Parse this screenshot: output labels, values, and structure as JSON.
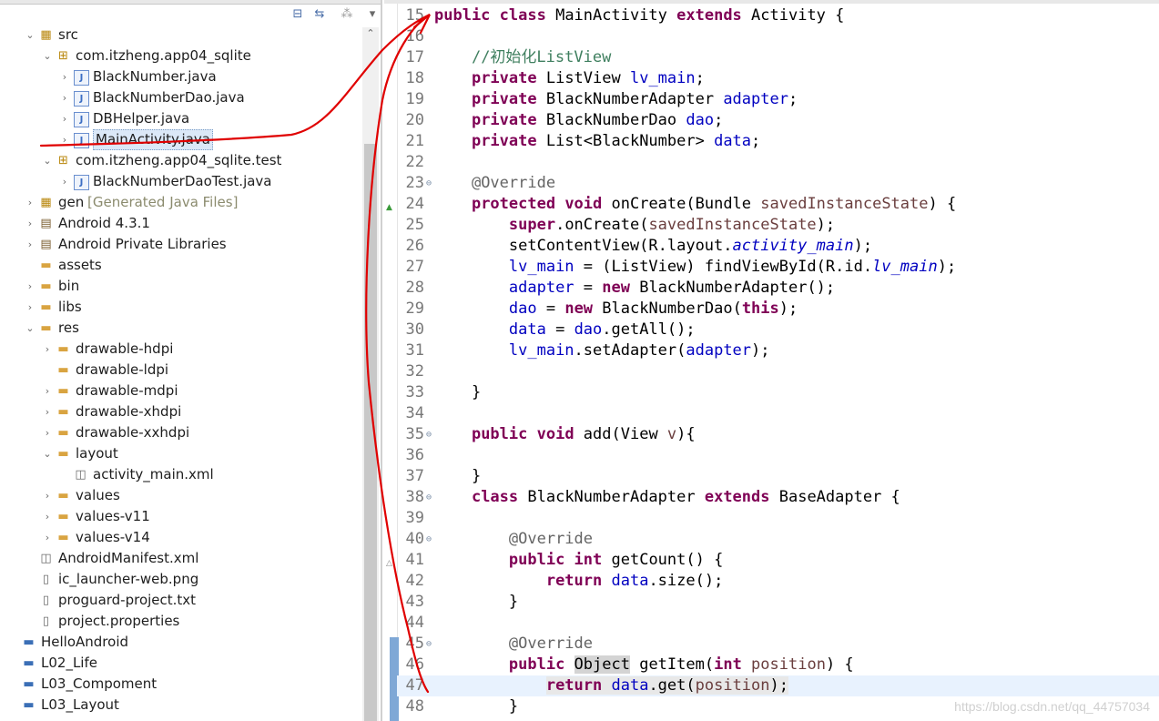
{
  "explorer": {
    "toolbar": {
      "collapse_icon": "collapse-all-icon",
      "link_icon": "link-with-editor-icon",
      "filter_icon": "filters-icon",
      "menu_icon": "view-menu-icon"
    },
    "tree": [
      {
        "id": "src",
        "label": "src",
        "indent": 1,
        "chev": "expanded",
        "icon": "package-folder-icon"
      },
      {
        "id": "pkg-main",
        "label": "com.itzheng.app04_sqlite",
        "indent": 2,
        "chev": "expanded",
        "icon": "package-icon"
      },
      {
        "id": "file-blacknumber",
        "label": "BlackNumber.java",
        "indent": 3,
        "chev": "collapsed",
        "icon": "java-file-icon"
      },
      {
        "id": "file-blacknumberdao",
        "label": "BlackNumberDao.java",
        "indent": 3,
        "chev": "collapsed",
        "icon": "java-file-icon"
      },
      {
        "id": "file-dbhelper",
        "label": "DBHelper.java",
        "indent": 3,
        "chev": "collapsed",
        "icon": "java-file-icon"
      },
      {
        "id": "file-mainactivity",
        "label": "MainActivity.java",
        "indent": 3,
        "chev": "collapsed",
        "icon": "java-file-icon",
        "selected": true
      },
      {
        "id": "pkg-test",
        "label": "com.itzheng.app04_sqlite.test",
        "indent": 2,
        "chev": "expanded",
        "icon": "package-icon"
      },
      {
        "id": "file-daotest",
        "label": "BlackNumberDaoTest.java",
        "indent": 3,
        "chev": "collapsed",
        "icon": "java-file-icon"
      },
      {
        "id": "gen",
        "label": "gen",
        "decor": "[Generated Java Files]",
        "indent": 1,
        "chev": "collapsed",
        "icon": "package-folder-icon"
      },
      {
        "id": "android",
        "label": "Android 4.3.1",
        "indent": 1,
        "chev": "collapsed",
        "icon": "library-icon"
      },
      {
        "id": "private-libs",
        "label": "Android Private Libraries",
        "indent": 1,
        "chev": "collapsed",
        "icon": "library-icon"
      },
      {
        "id": "assets",
        "label": "assets",
        "indent": 1,
        "chev": "none",
        "icon": "folder-icon"
      },
      {
        "id": "bin",
        "label": "bin",
        "indent": 1,
        "chev": "collapsed",
        "icon": "folder-icon"
      },
      {
        "id": "libs",
        "label": "libs",
        "indent": 1,
        "chev": "collapsed",
        "icon": "folder-icon"
      },
      {
        "id": "res",
        "label": "res",
        "indent": 1,
        "chev": "expanded",
        "icon": "folder-icon"
      },
      {
        "id": "drawable-hdpi",
        "label": "drawable-hdpi",
        "indent": 2,
        "chev": "collapsed",
        "icon": "folder-icon"
      },
      {
        "id": "drawable-ldpi",
        "label": "drawable-ldpi",
        "indent": 2,
        "chev": "none",
        "icon": "folder-icon"
      },
      {
        "id": "drawable-mdpi",
        "label": "drawable-mdpi",
        "indent": 2,
        "chev": "collapsed",
        "icon": "folder-icon"
      },
      {
        "id": "drawable-xhdpi",
        "label": "drawable-xhdpi",
        "indent": 2,
        "chev": "collapsed",
        "icon": "folder-icon"
      },
      {
        "id": "drawable-xxhdpi",
        "label": "drawable-xxhdpi",
        "indent": 2,
        "chev": "collapsed",
        "icon": "folder-icon"
      },
      {
        "id": "layout",
        "label": "layout",
        "indent": 2,
        "chev": "expanded",
        "icon": "folder-icon"
      },
      {
        "id": "activity-main-xml",
        "label": "activity_main.xml",
        "indent": 3,
        "chev": "none",
        "icon": "xml-file-icon"
      },
      {
        "id": "values",
        "label": "values",
        "indent": 2,
        "chev": "collapsed",
        "icon": "folder-icon"
      },
      {
        "id": "values-v11",
        "label": "values-v11",
        "indent": 2,
        "chev": "collapsed",
        "icon": "folder-icon"
      },
      {
        "id": "values-v14",
        "label": "values-v14",
        "indent": 2,
        "chev": "collapsed",
        "icon": "folder-icon"
      },
      {
        "id": "manifest",
        "label": "AndroidManifest.xml",
        "indent": 1,
        "chev": "none",
        "icon": "xml-file-icon"
      },
      {
        "id": "ic-launcher",
        "label": "ic_launcher-web.png",
        "indent": 1,
        "chev": "none",
        "icon": "image-file-icon"
      },
      {
        "id": "proguard",
        "label": "proguard-project.txt",
        "indent": 1,
        "chev": "none",
        "icon": "text-file-icon"
      },
      {
        "id": "project-props",
        "label": "project.properties",
        "indent": 1,
        "chev": "none",
        "icon": "text-file-icon"
      },
      {
        "id": "hello-android",
        "label": "HelloAndroid",
        "indent": 0,
        "chev": "none",
        "icon": "project-icon"
      },
      {
        "id": "l02-life",
        "label": "L02_Life",
        "indent": 0,
        "chev": "none",
        "icon": "project-icon"
      },
      {
        "id": "l03-compoment",
        "label": "L03_Compoment",
        "indent": 0,
        "chev": "none",
        "icon": "project-icon"
      },
      {
        "id": "l03-layout",
        "label": "L03_Layout",
        "indent": 0,
        "chev": "none",
        "icon": "project-icon"
      }
    ]
  },
  "editor": {
    "lines": [
      {
        "n": "15",
        "fold": "",
        "marker": "",
        "tokens": [
          [
            "kw",
            "public "
          ],
          [
            "kw",
            "class "
          ],
          [
            "",
            "MainActivity "
          ],
          [
            "kw",
            "extends "
          ],
          [
            "",
            "Activity {"
          ]
        ]
      },
      {
        "n": "16",
        "fold": "",
        "marker": "",
        "tokens": []
      },
      {
        "n": "17",
        "fold": "",
        "marker": "",
        "tokens": [
          [
            "",
            "    "
          ],
          [
            "cm",
            "//初始化ListView"
          ]
        ]
      },
      {
        "n": "18",
        "fold": "",
        "marker": "",
        "tokens": [
          [
            "",
            "    "
          ],
          [
            "kw",
            "private "
          ],
          [
            "",
            "ListView "
          ],
          [
            "fld",
            "lv_main"
          ],
          [
            "",
            ";"
          ]
        ]
      },
      {
        "n": "19",
        "fold": "",
        "marker": "",
        "tokens": [
          [
            "",
            "    "
          ],
          [
            "kw",
            "private "
          ],
          [
            "",
            "BlackNumberAdapter "
          ],
          [
            "fld",
            "adapter"
          ],
          [
            "",
            ";"
          ]
        ]
      },
      {
        "n": "20",
        "fold": "",
        "marker": "",
        "tokens": [
          [
            "",
            "    "
          ],
          [
            "kw",
            "private "
          ],
          [
            "",
            "BlackNumberDao "
          ],
          [
            "fld",
            "dao"
          ],
          [
            "",
            ";"
          ]
        ]
      },
      {
        "n": "21",
        "fold": "",
        "marker": "",
        "tokens": [
          [
            "",
            "    "
          ],
          [
            "kw",
            "private "
          ],
          [
            "",
            "List<BlackNumber> "
          ],
          [
            "fld",
            "data"
          ],
          [
            "",
            ";"
          ]
        ]
      },
      {
        "n": "22",
        "fold": "",
        "marker": "",
        "tokens": []
      },
      {
        "n": "23",
        "fold": "⊖",
        "marker": "",
        "tokens": [
          [
            "",
            "    "
          ],
          [
            "ann",
            "@Override"
          ]
        ]
      },
      {
        "n": "24",
        "fold": "",
        "marker": "override",
        "tokens": [
          [
            "",
            "    "
          ],
          [
            "kw",
            "protected "
          ],
          [
            "kw",
            "void "
          ],
          [
            "",
            "onCreate(Bundle "
          ],
          [
            "par",
            "savedInstanceState"
          ],
          [
            "",
            ") {"
          ]
        ]
      },
      {
        "n": "25",
        "fold": "",
        "marker": "",
        "tokens": [
          [
            "",
            "        "
          ],
          [
            "kw",
            "super"
          ],
          [
            "",
            ".onCreate("
          ],
          [
            "par",
            "savedInstanceState"
          ],
          [
            "",
            ");"
          ]
        ]
      },
      {
        "n": "26",
        "fold": "",
        "marker": "",
        "tokens": [
          [
            "",
            "        setContentView(R.layout."
          ],
          [
            "ital",
            "activity_main"
          ],
          [
            "",
            ");"
          ]
        ]
      },
      {
        "n": "27",
        "fold": "",
        "marker": "",
        "tokens": [
          [
            "",
            "        "
          ],
          [
            "fld",
            "lv_main"
          ],
          [
            "",
            " = (ListView) findViewById(R.id."
          ],
          [
            "ital",
            "lv_main"
          ],
          [
            "",
            ");"
          ]
        ]
      },
      {
        "n": "28",
        "fold": "",
        "marker": "",
        "tokens": [
          [
            "",
            "        "
          ],
          [
            "fld",
            "adapter"
          ],
          [
            "",
            " = "
          ],
          [
            "kw",
            "new "
          ],
          [
            "",
            "BlackNumberAdapter();"
          ]
        ]
      },
      {
        "n": "29",
        "fold": "",
        "marker": "",
        "tokens": [
          [
            "",
            "        "
          ],
          [
            "fld",
            "dao"
          ],
          [
            "",
            " = "
          ],
          [
            "kw",
            "new "
          ],
          [
            "",
            "BlackNumberDao("
          ],
          [
            "kw",
            "this"
          ],
          [
            "",
            ");"
          ]
        ]
      },
      {
        "n": "30",
        "fold": "",
        "marker": "",
        "tokens": [
          [
            "",
            "        "
          ],
          [
            "fld",
            "data"
          ],
          [
            "",
            " = "
          ],
          [
            "fld",
            "dao"
          ],
          [
            "",
            ".getAll();"
          ]
        ]
      },
      {
        "n": "31",
        "fold": "",
        "marker": "",
        "tokens": [
          [
            "",
            "        "
          ],
          [
            "fld",
            "lv_main"
          ],
          [
            "",
            ".setAdapter("
          ],
          [
            "fld",
            "adapter"
          ],
          [
            "",
            ");"
          ]
        ]
      },
      {
        "n": "32",
        "fold": "",
        "marker": "",
        "tokens": []
      },
      {
        "n": "33",
        "fold": "",
        "marker": "",
        "tokens": [
          [
            "",
            "    }"
          ]
        ]
      },
      {
        "n": "34",
        "fold": "",
        "marker": "",
        "tokens": []
      },
      {
        "n": "35",
        "fold": "⊖",
        "marker": "",
        "tokens": [
          [
            "",
            "    "
          ],
          [
            "kw",
            "public "
          ],
          [
            "kw",
            "void "
          ],
          [
            "",
            "add(View "
          ],
          [
            "par",
            "v"
          ],
          [
            "",
            "){"
          ]
        ]
      },
      {
        "n": "36",
        "fold": "",
        "marker": "",
        "tokens": []
      },
      {
        "n": "37",
        "fold": "",
        "marker": "",
        "tokens": [
          [
            "",
            "    }"
          ]
        ]
      },
      {
        "n": "38",
        "fold": "⊖",
        "marker": "",
        "tokens": [
          [
            "",
            "    "
          ],
          [
            "kw",
            "class "
          ],
          [
            "",
            "BlackNumberAdapter "
          ],
          [
            "kw",
            "extends "
          ],
          [
            "",
            "BaseAdapter {"
          ]
        ]
      },
      {
        "n": "39",
        "fold": "",
        "marker": "",
        "tokens": []
      },
      {
        "n": "40",
        "fold": "⊖",
        "marker": "",
        "tokens": [
          [
            "",
            "        "
          ],
          [
            "ann",
            "@Override"
          ]
        ]
      },
      {
        "n": "41",
        "fold": "",
        "marker": "implement",
        "tokens": [
          [
            "",
            "        "
          ],
          [
            "kw",
            "public "
          ],
          [
            "kw",
            "int "
          ],
          [
            "",
            "getCount() {"
          ]
        ]
      },
      {
        "n": "42",
        "fold": "",
        "marker": "",
        "tokens": [
          [
            "",
            "            "
          ],
          [
            "kw",
            "return "
          ],
          [
            "fld",
            "data"
          ],
          [
            "",
            ".size();"
          ]
        ]
      },
      {
        "n": "43",
        "fold": "",
        "marker": "",
        "tokens": [
          [
            "",
            "        }"
          ]
        ]
      },
      {
        "n": "44",
        "fold": "",
        "marker": "",
        "tokens": []
      },
      {
        "n": "45",
        "fold": "⊖",
        "marker": "",
        "tokens": [
          [
            "",
            "        "
          ],
          [
            "ann",
            "@Override"
          ]
        ]
      },
      {
        "n": "46",
        "fold": "",
        "marker": "",
        "tokens": [
          [
            "",
            "        "
          ],
          [
            "kw",
            "public "
          ],
          [
            "hl",
            "Object"
          ],
          [
            "",
            " getItem("
          ],
          [
            "kw",
            "int "
          ],
          [
            "par",
            "position"
          ],
          [
            "",
            ") {"
          ]
        ]
      },
      {
        "n": "47",
        "fold": "",
        "marker": "",
        "current": true,
        "tokens": [
          [
            "",
            "            "
          ],
          [
            "kw hl2",
            "return "
          ],
          [
            "fld hl2",
            "data"
          ],
          [
            "hl2",
            ".get("
          ],
          [
            "par hl2",
            "position"
          ],
          [
            "hl2",
            ");"
          ]
        ]
      },
      {
        "n": "48",
        "fold": "",
        "marker": "",
        "tokens": [
          [
            "",
            "        }"
          ]
        ]
      }
    ]
  },
  "watermark": "https://blog.csdn.net/qq_44757034",
  "colors": {
    "keyword": "#7f0055",
    "field": "#0000c0",
    "comment": "#3f7f5f",
    "annotation": "#646464",
    "parameter": "#6a3e3e",
    "annotation_ink": "#e00000"
  }
}
